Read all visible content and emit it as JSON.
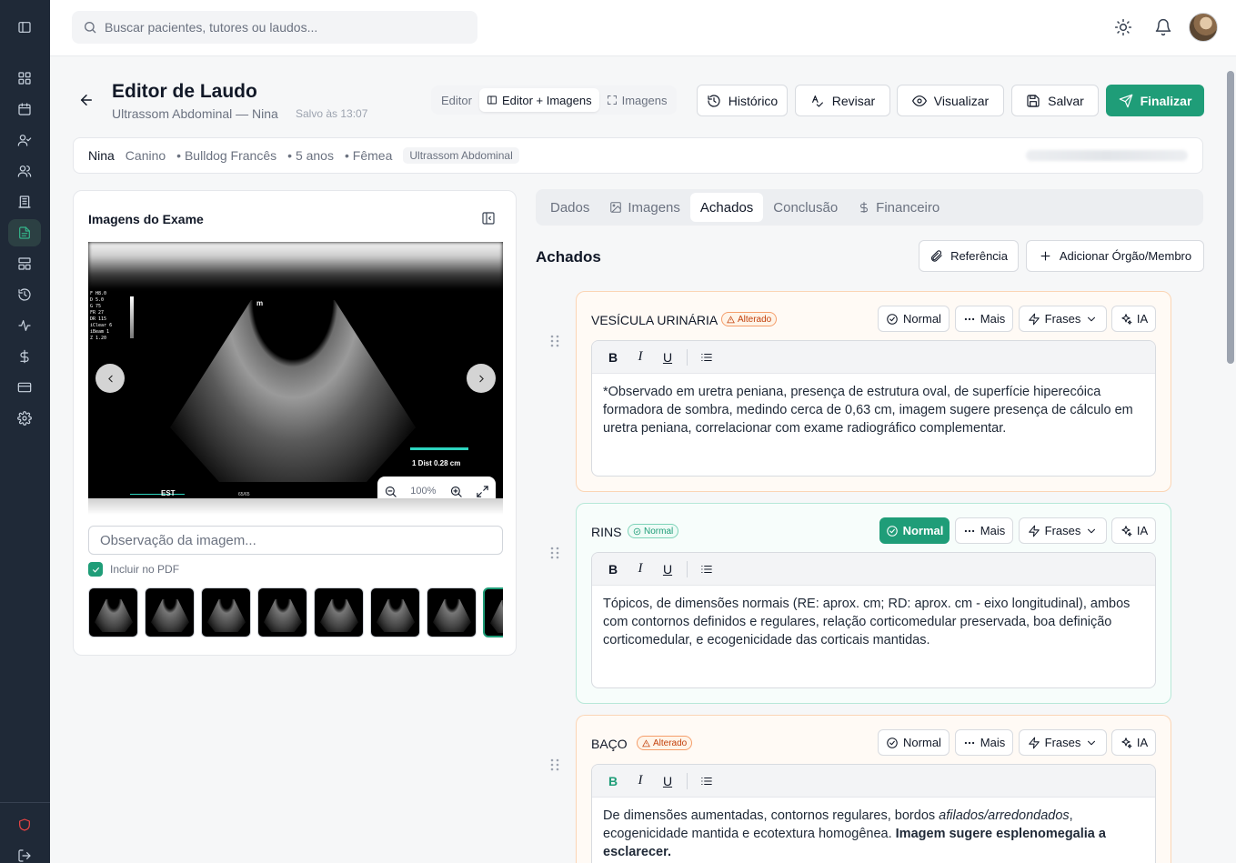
{
  "search": {
    "placeholder": "Buscar pacientes, tutores ou laudos..."
  },
  "header": {
    "title": "Editor de Laudo",
    "subtitle": "Ultrassom Abdominal — Nina",
    "saved": "Salvo às 13:07",
    "view_modes": [
      "Editor",
      "Editor + Imagens",
      "Imagens"
    ],
    "actions": {
      "history": "Histórico",
      "review": "Revisar",
      "preview": "Visualizar",
      "save": "Salvar",
      "finish": "Finalizar"
    }
  },
  "patient": {
    "name": "Nina",
    "species": "Canino",
    "breed": "Bulldog Francês",
    "age": "5 anos",
    "sex": "Fêmea",
    "exam_tag": "Ultrassom Abdominal"
  },
  "images_panel": {
    "title": "Imagens do Exame",
    "zoom": "100%",
    "overlay": {
      "params": "F H8.0\nD 5.0\nG 75\nFR 27\nDR 115\niClear 6\niBeam 1\nZ 1.20",
      "marker": "m",
      "dist": "1  Dist   0.28 cm",
      "est": "EST",
      "frame": "65/65"
    },
    "observation_placeholder": "Observação da imagem...",
    "include_pdf": "Incluir no PDF"
  },
  "tabs": [
    "Dados",
    "Imagens",
    "Achados",
    "Conclusão",
    "Financeiro"
  ],
  "findings": {
    "title": "Achados",
    "reference_btn": "Referência",
    "add_btn": "Adicionar Órgão/Membro",
    "btn_labels": {
      "normal": "Normal",
      "more": "Mais",
      "phrases": "Frases",
      "ai": "IA"
    },
    "organs": [
      {
        "name": "VESÍCULA URINÁRIA",
        "status": "Alterado",
        "text": "*Observado em uretra peniana, presença de estrutura oval, de superfície hiperecóica formadora de sombra, medindo cerca de 0,63 cm, imagem sugere presença de cálculo em uretra peniana, correlacionar com exame radiográfico complementar."
      },
      {
        "name": "RINS",
        "status": "Normal",
        "text": "Tópicos, de dimensões normais (RE: aprox. cm; RD: aprox. cm - eixo longitudinal), ambos com contornos definidos e regulares, relação corticomedular preservada, boa definição corticomedular, e ecogenicidade das corticais mantidas."
      },
      {
        "name": "BAÇO",
        "status": "Alterado",
        "text_a": "De dimensões aumentadas, contornos regulares, bordos ",
        "text_b": "afilados/arredondados",
        "text_c": ", ecogenicidade mantida e ecotextura homogênea. ",
        "text_d": "Imagem sugere esplenomegalia a esclarecer."
      }
    ]
  },
  "colors": {
    "brand": "#1f9d78",
    "sidebar": "#1f2937",
    "warn": "#c2410c"
  }
}
